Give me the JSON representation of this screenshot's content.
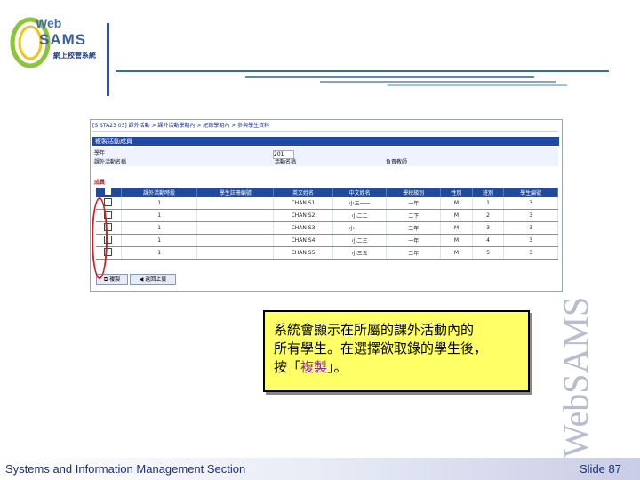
{
  "logo": {
    "web": "Web",
    "sams": "SAMS",
    "subtitle": "網上校管系統"
  },
  "screenshot": {
    "title_bar": "[S STA23 03] 課外活動 > 課外活動學期內 > 紀錄學期內 > 參與學生資料",
    "section_title": "複製活動成員",
    "form": {
      "year_label": "學年",
      "year_value": "201",
      "activity_label": "課外活動名稱",
      "activity_value": "活動名稱",
      "teacher_label": "負責教師"
    },
    "students_label": "成員",
    "columns": [
      "",
      "課外活動時段",
      "學生註冊編號",
      "英文姓名",
      "中文姓名",
      "學校級別",
      "性別",
      "班別",
      "學生編號"
    ],
    "rows": [
      [
        "",
        "1",
        "",
        "CHAN S1",
        "小三一一",
        "一年",
        "M",
        "1",
        "3"
      ],
      [
        "",
        "1",
        "",
        "CHAN S2",
        "小二二",
        "二下",
        "M",
        "2",
        "3"
      ],
      [
        "",
        "1",
        "",
        "CHAN S3",
        "小一一一",
        "二年",
        "M",
        "3",
        "3"
      ],
      [
        "",
        "1",
        "",
        "CHAN S4",
        "小二三",
        "一年",
        "M",
        "4",
        "3"
      ],
      [
        "",
        "1",
        "",
        "CHAN S5",
        "小三五",
        "二年",
        "M",
        "5",
        "3"
      ]
    ],
    "copy_button": "複製",
    "back_button": "返回上頁"
  },
  "callout": {
    "line1": "系統會顯示在所屬的課外活動內的",
    "line2": "所有學生。在選擇欲取錄的學生後，",
    "line3_pre": "按「",
    "line3_hl": "複製",
    "line3_post": "」。"
  },
  "watermark": "WebSAMS",
  "footer": {
    "left": "Systems and Information Management Section",
    "right": "Slide 87"
  },
  "colors": {
    "header_blue": "#1f4aa0",
    "callout_yellow": "#ffff66",
    "highlight_purple": "#8b2ea0",
    "oval_red": "#d8181f"
  }
}
